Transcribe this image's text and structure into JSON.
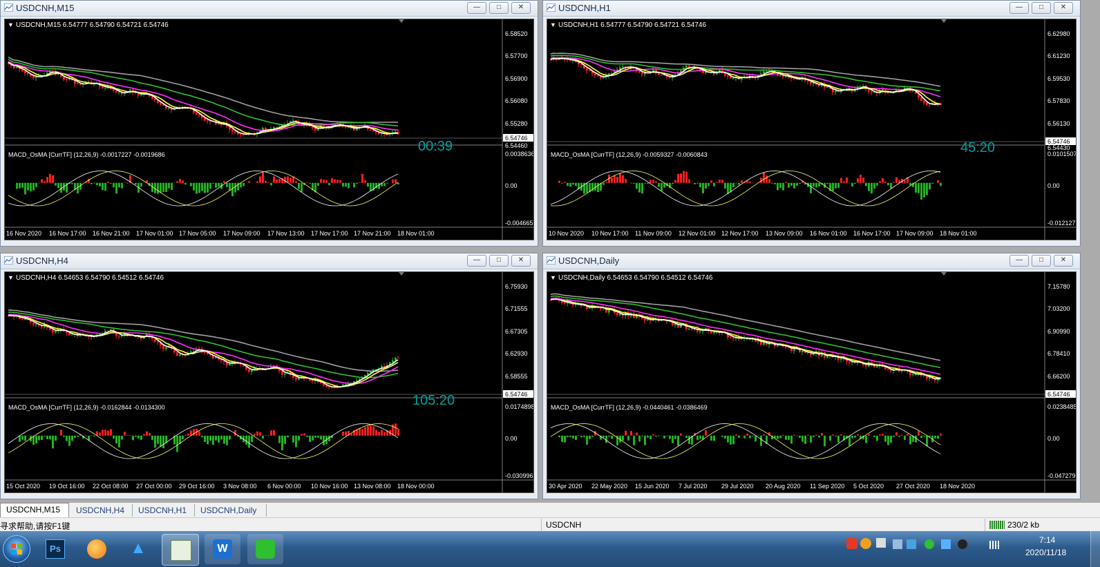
{
  "windows": [
    {
      "title": "USDCNH,M15",
      "info": "USDCNH,M15  6.54777 6.54790 6.54721 6.54746",
      "prices": [
        "6.58520",
        "6.57700",
        "6.56900",
        "6.56080",
        "6.55280",
        "6.54746",
        "6.54460"
      ],
      "countdown": "00:39",
      "macd_label": "MACD_OsMA [CurrTF] (12,26,9) -0.0017227 -0.0019686",
      "macd_scale": [
        "0.0038636",
        "0.00",
        "-0.004665"
      ],
      "dates": [
        "16 Nov 2020",
        "16 Nov 17:00",
        "16 Nov 21:00",
        "17 Nov 01:00",
        "17 Nov 05:00",
        "17 Nov 09:00",
        "17 Nov 13:00",
        "17 Nov 17:00",
        "17 Nov 21:00",
        "18 Nov 01:00"
      ]
    },
    {
      "title": "USDCNH,H1",
      "info": "USDCNH,H1  6.54777 6.54790 6.54721 6.54746",
      "prices": [
        "6.62980",
        "6.61230",
        "6.59530",
        "6.57830",
        "6.56130",
        "6.54746",
        "6.54430"
      ],
      "countdown": "45:20",
      "macd_label": "MACD_OsMA [CurrTF] (12,26,9) -0.0059327 -0.0060843",
      "macd_scale": [
        "0.0101507",
        "0.00",
        "-0.012127"
      ],
      "dates": [
        "10 Nov 2020",
        "10 Nov 17:00",
        "11 Nov 09:00",
        "12 Nov 01:00",
        "12 Nov 17:00",
        "13 Nov 09:00",
        "16 Nov 01:00",
        "16 Nov 17:00",
        "17 Nov 09:00",
        "18 Nov 01:00"
      ]
    },
    {
      "title": "USDCNH,H4",
      "info": "USDCNH,H4  6.54653 6.54790 6.54512 6.54746",
      "prices": [
        "6.75930",
        "6.71555",
        "6.67305",
        "6.62930",
        "6.58555",
        "6.54746"
      ],
      "countdown": "105:20",
      "macd_label": "MACD_OsMA [CurrTF] (12,26,9) -0.0162844 -0.0134300",
      "macd_scale": [
        "0.0174898",
        "0.00",
        "-0.030996"
      ],
      "dates": [
        "15 Oct 2020",
        "19 Oct 16:00",
        "22 Oct 08:00",
        "27 Oct 00:00",
        "29 Oct 16:00",
        "3 Nov 08:00",
        "6 Nov 00:00",
        "10 Nov 16:00",
        "13 Nov 08:00",
        "18 Nov 00:00"
      ]
    },
    {
      "title": "USDCNH,Daily",
      "info": "USDCNH,Daily  6.54653 6.54790 6.54512 6.54746",
      "prices": [
        "7.15780",
        "7.03200",
        "6.90990",
        "6.78410",
        "6.66200",
        "6.54746"
      ],
      "countdown": "",
      "macd_label": "MACD_OsMA [CurrTF] (12,26,9) -0.0440461 -0.0386469",
      "macd_scale": [
        "0.0238485",
        "0.00",
        "-0.047279"
      ],
      "dates": [
        "30 Apr 2020",
        "22 May 2020",
        "15 Jun 2020",
        "7 Jul 2020",
        "29 Jul 2020",
        "20 Aug 2020",
        "11 Sep 2020",
        "5 Oct 2020",
        "27 Oct 2020",
        "18 Nov 2020"
      ]
    }
  ],
  "tabs": [
    "USDCNH,M15",
    "USDCNH,H4",
    "USDCNH,H1",
    "USDCNH,Daily"
  ],
  "status": {
    "help": "寻求帮助,请按F1键",
    "symbol": "USDCNH",
    "traffic": "230/2 kb"
  },
  "taskbar": {
    "time": "7:14",
    "date": "2020/11/18",
    "apps": [
      "start-orb-icon",
      "photoshop-icon",
      "browser-icon",
      "cloud-app-icon",
      "metatrader-icon",
      "wps-icon",
      "wechat-icon"
    ]
  },
  "colors": {
    "bull": "#22b022",
    "bear": "#ff2020",
    "ma_white": "#ffffff",
    "ma_yellow": "#ffff40",
    "ma_magenta": "#ff30ff",
    "ma_green": "#30c030",
    "ma_gray": "#a0a0a0",
    "countdown": "#00a0a0"
  }
}
